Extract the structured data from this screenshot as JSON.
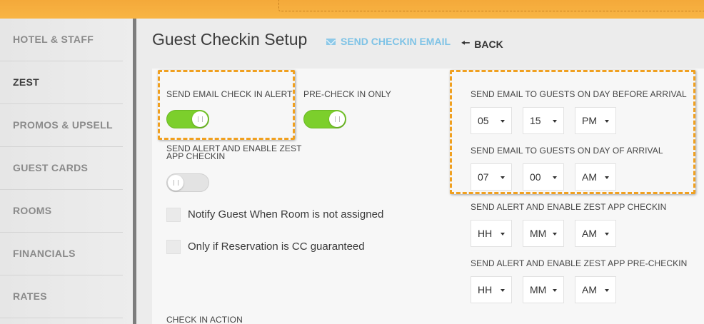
{
  "sidebar": {
    "items": [
      {
        "label": "HOTEL & STAFF"
      },
      {
        "label": "ZEST"
      },
      {
        "label": "PROMOS & UPSELL"
      },
      {
        "label": "GUEST CARDS"
      },
      {
        "label": "ROOMS"
      },
      {
        "label": "FINANCIALS"
      },
      {
        "label": "RATES"
      }
    ]
  },
  "header": {
    "title": "Guest Checkin Setup",
    "send_checkin_email": "SEND CHECKIN EMAIL",
    "back": "BACK"
  },
  "settings": {
    "send_email_alert_label": "SEND EMAIL CHECK IN ALERT",
    "send_email_alert_on": true,
    "pre_checkin_only_label": "PRE-CHECK IN ONLY",
    "pre_checkin_only_on": true,
    "zest_app_checkin_label": "SEND ALERT AND ENABLE ZEST APP CHECKIN",
    "zest_app_checkin_on": false,
    "notify_room_not_assigned_label": "Notify Guest When Room is not assigned",
    "notify_room_not_assigned_checked": false,
    "cc_guaranteed_label": "Only if Reservation is CC guaranteed",
    "cc_guaranteed_checked": false,
    "check_in_action_label": "CHECK IN ACTION"
  },
  "schedule": {
    "day_before": {
      "label": "SEND EMAIL TO GUESTS ON DAY BEFORE ARRIVAL",
      "hour": "05",
      "minute": "15",
      "ampm": "PM"
    },
    "day_of": {
      "label": "SEND EMAIL TO GUESTS ON DAY OF ARRIVAL",
      "hour": "07",
      "minute": "00",
      "ampm": "AM"
    },
    "zest_checkin": {
      "label": "SEND ALERT AND ENABLE ZEST APP CHECKIN",
      "hour": "HH",
      "minute": "MM",
      "ampm": "AM"
    },
    "zest_precheckin": {
      "label": "SEND ALERT AND ENABLE ZEST APP PRE-CHECKIN",
      "hour": "HH",
      "minute": "MM",
      "ampm": "AM"
    }
  },
  "colors": {
    "toggle_on": "#7ccf2c",
    "highlight": "#f0a020",
    "link": "#7fc3e6",
    "banner": "#f6ad3e"
  }
}
